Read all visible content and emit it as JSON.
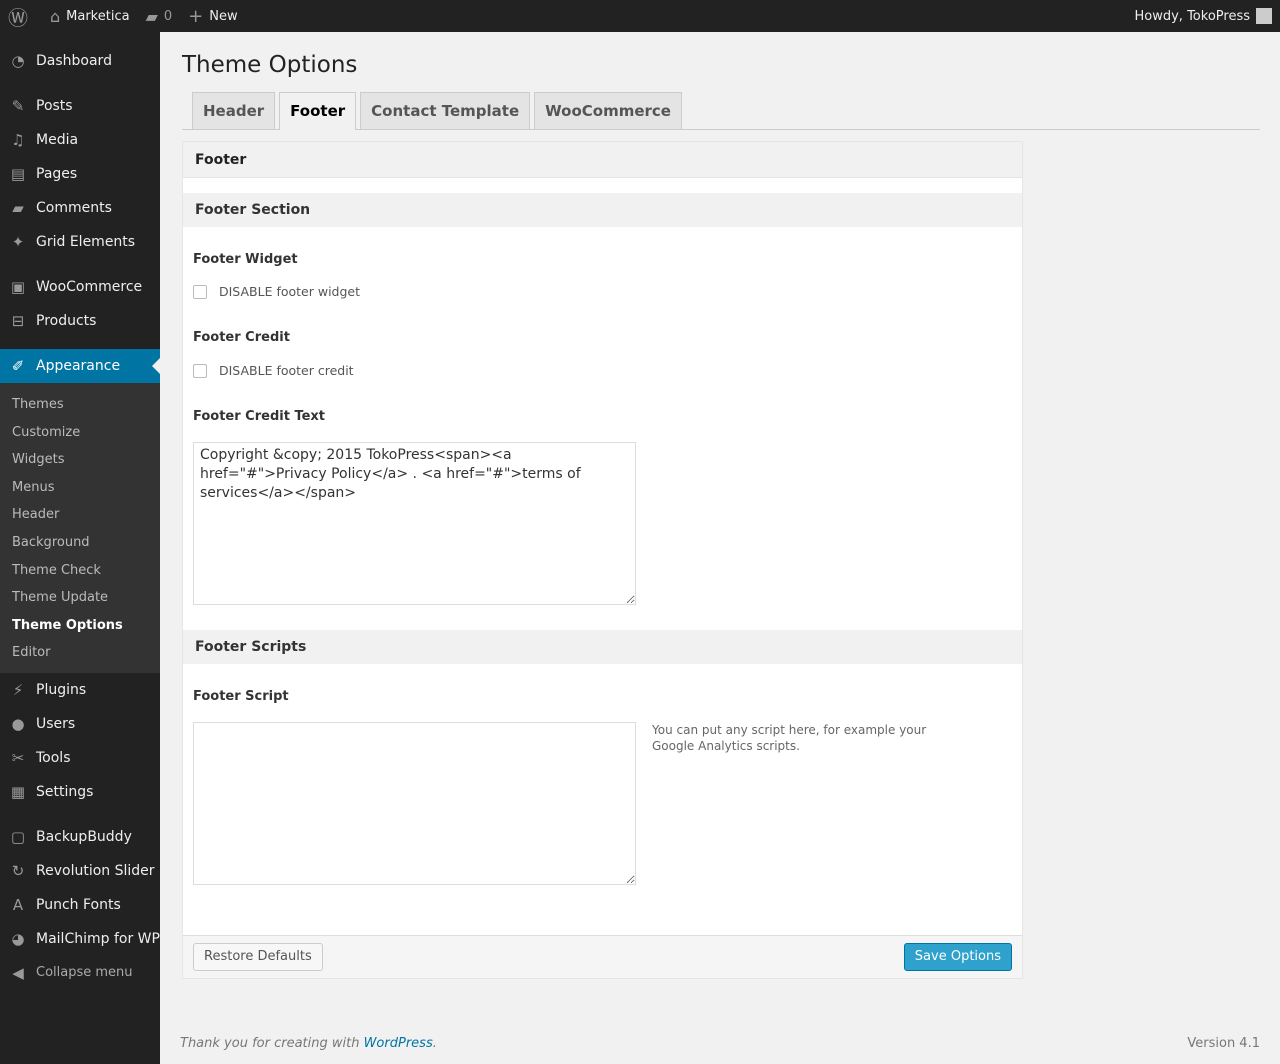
{
  "adminbar": {
    "site": "Marketica",
    "comments": "0",
    "new": "New",
    "howdy": "Howdy, TokoPress"
  },
  "sidebar": {
    "group1": [
      {
        "label": "Dashboard",
        "icon": "dashboard-icon",
        "g": "◔"
      }
    ],
    "group2": [
      {
        "label": "Posts",
        "icon": "pin-icon",
        "g": "✎"
      },
      {
        "label": "Media",
        "icon": "media-icon",
        "g": "♫"
      },
      {
        "label": "Pages",
        "icon": "pages-icon",
        "g": "▤"
      },
      {
        "label": "Comments",
        "icon": "comment-icon",
        "g": "▰"
      },
      {
        "label": "Grid Elements",
        "icon": "grid-icon",
        "g": "✦"
      }
    ],
    "group3": [
      {
        "label": "WooCommerce",
        "icon": "woo-icon",
        "g": "▣"
      },
      {
        "label": "Products",
        "icon": "cart-icon",
        "g": "⊟"
      }
    ],
    "appearance": {
      "label": "Appearance",
      "icon": "brush-icon",
      "g": "✐"
    },
    "submenu": [
      "Themes",
      "Customize",
      "Widgets",
      "Menus",
      "Header",
      "Background",
      "Theme Check",
      "Theme Update",
      "Theme Options",
      "Editor"
    ],
    "submenu_current": "Theme Options",
    "group5": [
      {
        "label": "Plugins",
        "icon": "plugin-icon",
        "g": "⚡"
      },
      {
        "label": "Users",
        "icon": "user-icon",
        "g": "●"
      },
      {
        "label": "Tools",
        "icon": "wrench-icon",
        "g": "✂"
      },
      {
        "label": "Settings",
        "icon": "settings-icon",
        "g": "▦"
      }
    ],
    "group6": [
      {
        "label": "BackupBuddy",
        "icon": "backup-icon",
        "g": "▢"
      },
      {
        "label": "Revolution Slider",
        "icon": "refresh-icon",
        "g": "↻"
      },
      {
        "label": "Punch Fonts",
        "icon": "font-icon",
        "g": "A"
      },
      {
        "label": "MailChimp for WP",
        "icon": "mailchimp-icon",
        "g": "◕"
      },
      {
        "label": "Collapse menu",
        "icon": "collapse-icon",
        "g": "◀"
      }
    ]
  },
  "page": {
    "title": "Theme Options",
    "tabs": [
      "Header",
      "Footer",
      "Contact Template",
      "WooCommerce"
    ],
    "active_tab": "Footer"
  },
  "panel": {
    "title": "Footer",
    "section1": "Footer Section",
    "widget_label": "Footer Widget",
    "widget_cb": "DISABLE footer widget",
    "widget_checked": false,
    "credit_label": "Footer Credit",
    "credit_cb": "DISABLE footer credit",
    "credit_checked": false,
    "credit_text_label": "Footer Credit Text",
    "credit_text": "Copyright &copy; 2015 TokoPress<span><a href=\"#\">Privacy Policy</a> . <a href=\"#\">terms of services</a></span>",
    "section2": "Footer Scripts",
    "script_label": "Footer Script",
    "script_value": "",
    "script_desc": "You can put any script here, for example your Google Analytics scripts.",
    "restore": "Restore Defaults",
    "save": "Save Options"
  },
  "footer": {
    "thanks": "Thank you for creating with ",
    "wp": "WordPress",
    "period": ".",
    "version": "Version 4.1"
  }
}
